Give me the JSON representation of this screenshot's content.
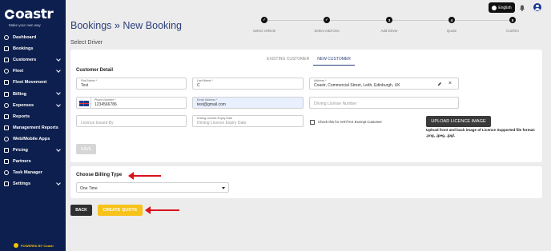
{
  "brand": {
    "logo_text": "oastr",
    "tagline": "Make your own way",
    "powered_by": "POWERED BY Coastr"
  },
  "header": {
    "language": "English"
  },
  "sidebar": {
    "items": [
      {
        "label": "Dashboard",
        "icon": "dashboard-icon",
        "has_children": false
      },
      {
        "label": "Bookings",
        "icon": "bookings-icon",
        "has_children": false
      },
      {
        "label": "Customers",
        "icon": "customers-icon",
        "has_children": true
      },
      {
        "label": "Fleet",
        "icon": "fleet-icon",
        "has_children": true
      },
      {
        "label": "Fleet Movement",
        "icon": "fleet-movement-icon",
        "has_children": false
      },
      {
        "label": "Billing",
        "icon": "billing-icon",
        "has_children": true
      },
      {
        "label": "Expenses",
        "icon": "expenses-icon",
        "has_children": true
      },
      {
        "label": "Reports",
        "icon": "reports-icon",
        "has_children": false
      },
      {
        "label": "Management Reports",
        "icon": "management-reports-icon",
        "has_children": false
      },
      {
        "label": "Web/Mobile Apps",
        "icon": "web-mobile-icon",
        "has_children": false
      },
      {
        "label": "Pricing",
        "icon": "pricing-icon",
        "has_children": true
      },
      {
        "label": "Partners",
        "icon": "partners-icon",
        "has_children": false
      },
      {
        "label": "Task Manager",
        "icon": "task-manager-icon",
        "has_children": false
      },
      {
        "label": "Settings",
        "icon": "settings-icon",
        "has_children": true
      }
    ]
  },
  "page": {
    "title": "Bookings  »  New  Booking",
    "subtitle": "Select Driver"
  },
  "stepper": {
    "steps": [
      {
        "label": "Select Vehicle",
        "marker": "✓"
      },
      {
        "label": "Select Add-Ons",
        "marker": "✓"
      },
      {
        "label": "Add Driver",
        "marker": "3"
      },
      {
        "label": "Quote",
        "marker": "4"
      },
      {
        "label": "Confirm",
        "marker": "5"
      }
    ]
  },
  "customer_tabs": {
    "existing": "EXISTING CUSTOMER",
    "new": "NEW CUSTOMER"
  },
  "customer_detail": {
    "heading": "Customer Detail",
    "first_name": {
      "label": "First Name *",
      "value": "Test"
    },
    "last_name": {
      "label": "Last Name *",
      "value": "C"
    },
    "address": {
      "label": "Address *",
      "value": "Coastr, Commercial Street, Leith, Edinburgh, UK"
    },
    "phone": {
      "label": "Phone Number *",
      "value": "1234566786"
    },
    "email": {
      "label": "Email Address *",
      "value": "test@gmail.com"
    },
    "driving_license_number": {
      "placeholder": "Driving License Number"
    },
    "licence_issued_by": {
      "placeholder": "Licence Issued By"
    },
    "license_expiry": {
      "label": "Driving License Expiry Date",
      "placeholder": "Driving Licence Expiry Date"
    },
    "vat_exempt_label": "Check this for VAT/TAX Exempt Customer",
    "upload_button": "UPLOAD LICENCE IMAGE",
    "upload_note": "Upload front and back image of Licence Supported file format: .png, .jpeg, .jpg/.",
    "save_button": "SAVE"
  },
  "billing": {
    "heading": "Choose Billing Type",
    "selected": "One Time"
  },
  "actions": {
    "back": "BACK",
    "create_quote": "CREATE QUOTE"
  },
  "colors": {
    "sidebar": "#0d1f4e",
    "accent": "#2b3f7a",
    "quote_button": "#f7c21a",
    "arrow": "#d9121b"
  }
}
